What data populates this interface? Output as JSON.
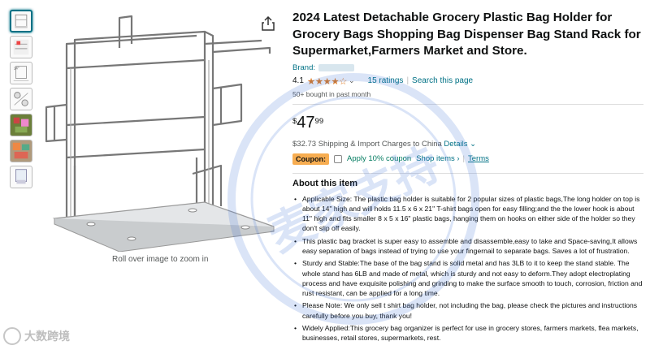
{
  "product": {
    "title": "2024 Latest Detachable Grocery Plastic Bag Holder for Grocery Bags Shopping Bag Dispenser Bag Stand Rack for Supermarket,Farmers Market and Store.",
    "brand_label": "Brand:",
    "rating_value": "4.1",
    "stars": "★★★★☆",
    "ratings_count": "15 ratings",
    "search_page": "Search this page",
    "bought": "50+ bought in past month",
    "price_symbol": "$",
    "price_whole": "47",
    "price_fraction": "99",
    "shipping": "$32.73 Shipping & Import Charges to China",
    "shipping_details": "Details",
    "coupon_label": "Coupon:",
    "coupon_text": "Apply 10% coupon",
    "coupon_shop": "Shop items ›",
    "coupon_pipe": "|",
    "coupon_terms": "Terms",
    "rating_color": "#de7921",
    "link_color": "#007185"
  },
  "gallery": {
    "zoom_note": "Roll over image to zoom in",
    "thumb_count": 7,
    "selected_index": 0
  },
  "about": {
    "heading": "About this item",
    "bullets": [
      "Applicable Size: The plastic bag holder is suitable for 2 popular sizes of plastic bags,The long holder on top is about 14\" high and will holds 11.5 x 6 x 21\" T-shirt bags open for easy filling;and the the lower hook is about 11\" high and fits smaller 8 x 5 x 16\" plastic bags, hanging them on hooks on either side of the holder so they don't slip off easily.",
      "This plastic bag bracket is super easy to assemble and disassemble,easy to take and Space-saving,It allows easy separation of bags instead of trying to use your fingernail to separate bags. Saves a lot of frustration.",
      "Sturdy and Stable:The base of the bag stand is solid metal and has 3LB to it to keep the stand stable. The whole stand has 6LB and made of metal, which is sturdy and not easy to deform.They adopt electroplating process and have exquisite polishing and grinding to make the surface smooth to touch, corrosion, friction and rust resistant, can be applied for a long time.",
      "Please Note: We only sell t shirt bag holder, not including the bag, please check the pictures and instructions carefully before you buy, thank you!",
      "Widely Applied:This grocery bag organizer is perfect for use in grocery stores, farmers markets, flea markets, businesses, retail stores, supermarkets, rest."
    ]
  },
  "watermark": {
    "text": "大数跨境",
    "stamp_text": "麦家支持"
  }
}
